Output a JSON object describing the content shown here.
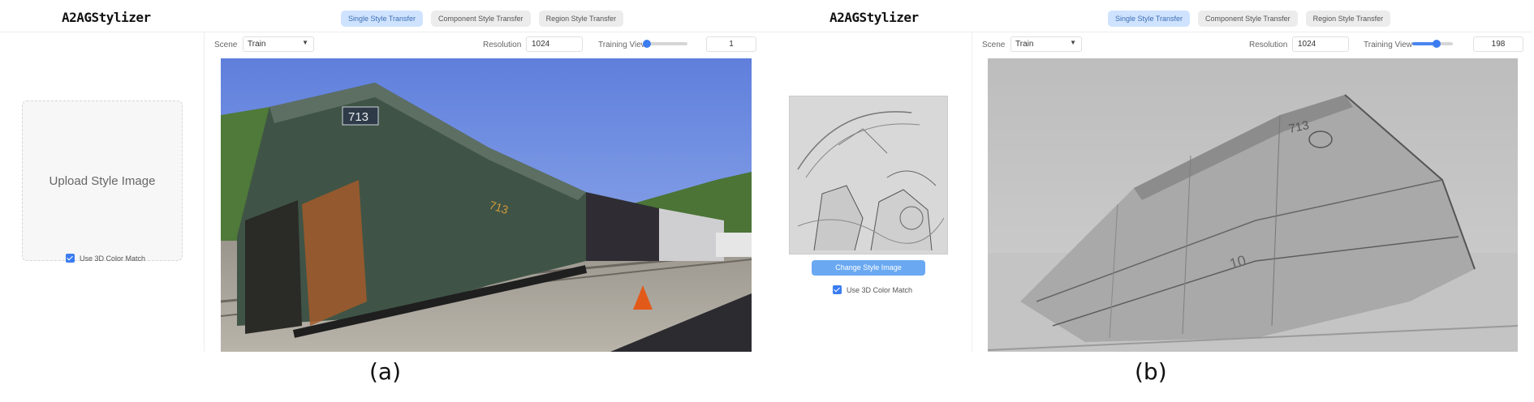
{
  "app": {
    "logo": "A2AGStylizer"
  },
  "tabs": [
    "Single Style Transfer",
    "Component Style Transfer",
    "Region Style Transfer"
  ],
  "active_tab": "Single Style Transfer",
  "controls": {
    "scene_label": "Scene",
    "resolution_label": "Resolution",
    "training_view_label": "Training View"
  },
  "panel_a": {
    "scene_value": "Train",
    "resolution_value": "1024",
    "training_view_value": "1",
    "training_view_level": 0.0,
    "upload_text": "Upload Style Image",
    "color_match_label": "Use 3D Color Match",
    "color_match_checked": true,
    "caption": "(a)"
  },
  "panel_b": {
    "scene_value": "Train",
    "resolution_value": "1024",
    "training_view_value": "198",
    "training_view_level": 0.6,
    "change_button": "Change Style Image",
    "color_match_label": "Use 3D Color Match",
    "color_match_checked": true,
    "caption": "(b)"
  },
  "colors": {
    "accent": "#3b7df0",
    "active_tab_bg": "#cfe3ff",
    "button": "#6aa9f2"
  },
  "icons": {
    "dropdown": "chevron-down-icon",
    "checkbox": "check-icon"
  }
}
